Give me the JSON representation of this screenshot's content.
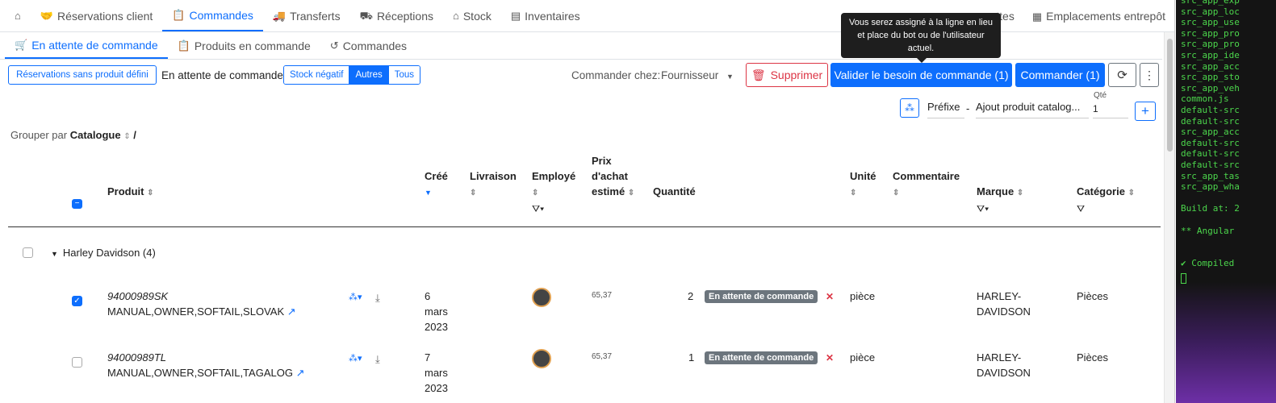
{
  "top_nav": {
    "home_icon": "home-icon",
    "items": [
      {
        "label": "Réservations client",
        "icon": "handshake-icon"
      },
      {
        "label": "Commandes",
        "icon": "clipboard-icon",
        "active": true
      },
      {
        "label": "Transferts",
        "icon": "truck-icon"
      },
      {
        "label": "Réceptions",
        "icon": "dolly-icon"
      },
      {
        "label": "Stock",
        "icon": "warehouse-icon"
      },
      {
        "label": "Inventaires",
        "icon": "inventory-icon"
      }
    ],
    "right_items": [
      {
        "label": "ettes"
      },
      {
        "label": "Emplacements entrepôt",
        "icon": "grid-icon"
      }
    ]
  },
  "sub_nav": {
    "items": [
      {
        "label": "En attente de commande",
        "icon": "cart-icon",
        "active": true
      },
      {
        "label": "Produits en commande",
        "icon": "clipboard-icon"
      },
      {
        "label": "Commandes",
        "icon": "history-icon"
      }
    ]
  },
  "toolbar": {
    "reservations_button": "Réservations sans produit défini",
    "status_label": "En attente de commande",
    "filters": [
      "Stock négatif",
      "Autres",
      "Tous"
    ],
    "active_filter": "Autres",
    "order_from_label": "Commander chez:",
    "order_from_value": "Fournisseur",
    "delete_button": "Supprimer",
    "validate_button": "Valider le besoin de commande (1)",
    "order_button": "Commander (1)",
    "tooltip": "Vous serez assigné à la ligne en lieu et place du bot ou de l'utilisateur actuel."
  },
  "add_row": {
    "prefix": "Préfixe",
    "dash": "-",
    "product_placeholder": "Ajout produit catalog...",
    "qty_label": "Qté",
    "qty_value": "1"
  },
  "grouping": {
    "label": "Grouper par",
    "value": "Catalogue",
    "separator": "/"
  },
  "table": {
    "columns": {
      "product": "Produit",
      "created": "Créé",
      "delivery": "Livraison",
      "employee": "Employé",
      "price": "Prix d'achat estimé",
      "price_l1": "Prix",
      "price_l2": "d'achat",
      "price_l3": "estimé",
      "quantity": "Quantité",
      "unit": "Unité",
      "comment": "Commentaire",
      "brand": "Marque",
      "category": "Catégorie"
    },
    "group": {
      "label": "Harley Davidson (4)"
    },
    "rows": [
      {
        "ref": "94000989SK",
        "name": "MANUAL,OWNER,SOFTAIL,SLOVAK",
        "created_day": "6",
        "created_month": "mars",
        "created_year": "2023",
        "price": "65,37",
        "qty": "2",
        "status": "En attente de commande",
        "unit": "pièce",
        "brand_l1": "HARLEY-",
        "brand_l2": "DAVIDSON",
        "category": "Pièces",
        "checked": true
      },
      {
        "ref": "94000989TL",
        "name": "MANUAL,OWNER,SOFTAIL,TAGALOG",
        "created_day": "7",
        "created_month": "mars",
        "created_year": "2023",
        "price": "65,37",
        "qty": "1",
        "status": "En attente de commande",
        "unit": "pièce",
        "brand_l1": "HARLEY-",
        "brand_l2": "DAVIDSON",
        "category": "Pièces",
        "checked": false
      }
    ]
  },
  "terminal": {
    "lines": [
      "src_app_exp",
      "src_app_loc",
      "src_app_use",
      "src_app_pro",
      "src_app_pro",
      "src_app_ide",
      "src_app_acc",
      "src_app_sto",
      "src_app_veh",
      "common.js",
      "default-src",
      "default-src",
      "src_app_acc",
      "default-src",
      "default-src",
      "default-src",
      "src_app_tas",
      "src_app_wha",
      "",
      "Build at: 2",
      "",
      "** Angular",
      "",
      "",
      "✔ Compiled"
    ]
  }
}
